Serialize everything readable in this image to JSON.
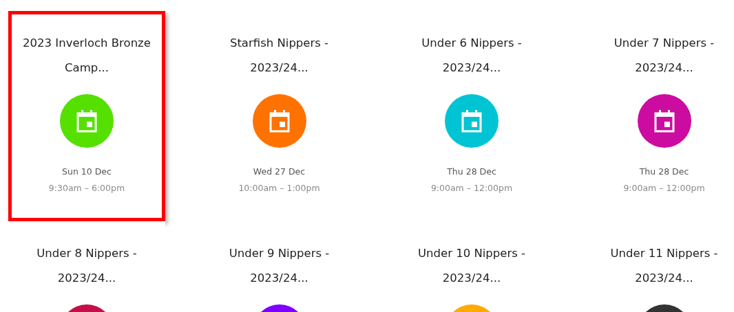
{
  "events": [
    {
      "title": "2023 Inverloch Bronze Camp...",
      "date": "Sun 10 Dec",
      "time": "9:30am – 6:00pm",
      "color": "#55e000",
      "selected": true
    },
    {
      "title": "Starfish Nippers - 2023/24...",
      "date": "Wed 27 Dec",
      "time": "10:00am – 1:00pm",
      "color": "#ff7200",
      "selected": false
    },
    {
      "title": "Under 6 Nippers - 2023/24...",
      "date": "Thu 28 Dec",
      "time": "9:00am – 12:00pm",
      "color": "#00c4d4",
      "selected": false
    },
    {
      "title": "Under 7 Nippers - 2023/24...",
      "date": "Thu 28 Dec",
      "time": "9:00am – 12:00pm",
      "color": "#cc0ca0",
      "selected": false
    },
    {
      "title": "Under 8 Nippers - 2023/24...",
      "color": "#c4104a",
      "selected": false
    },
    {
      "title": "Under 9 Nippers - 2023/24...",
      "color": "#8000ff",
      "selected": false
    },
    {
      "title": "Under 10 Nippers - 2023/24...",
      "color": "#ffaa00",
      "selected": false
    },
    {
      "title": "Under 11 Nippers - 2023/24...",
      "color": "#333333",
      "selected": false
    }
  ]
}
